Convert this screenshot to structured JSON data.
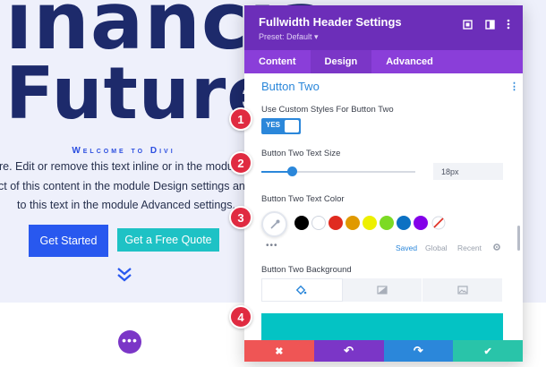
{
  "background_page": {
    "hero_word_1": "inancia",
    "hero_word_2": "Future",
    "welcome": "Welcome to Divi",
    "body_lines": [
      "ere. Edit or remove this text inline or in the module (",
      "ct of this content in the module Design settings and e",
      "to this text in the module Advanced settings."
    ],
    "primary_button": "Get Started",
    "secondary_button": "Get a Free Quote",
    "fab_label": "•••",
    "colors": {
      "hero_text": "#1d2a6b",
      "accent": "#2858ef",
      "teal": "#1ec2c5",
      "fab": "#7b36c7"
    }
  },
  "modal": {
    "title": "Fullwidth Header Settings",
    "preset": "Preset: Default ▾",
    "header_icons": [
      "fullscreen-icon",
      "split-view-icon",
      "more-options-icon"
    ],
    "tabs": [
      {
        "label": "Content",
        "active": false
      },
      {
        "label": "Design",
        "active": true
      },
      {
        "label": "Advanced",
        "active": false
      }
    ],
    "section_title": "Button Two",
    "custom_styles": {
      "label": "Use Custom Styles For Button Two",
      "toggle_text": "YES",
      "enabled": true
    },
    "text_size": {
      "label": "Button Two Text Size",
      "value": "18px",
      "slider_fraction": 0.19
    },
    "text_color": {
      "label": "Button Two Text Color",
      "swatches": [
        "#000000",
        "#ffffff",
        "#e02b20",
        "#e09900",
        "#edf000",
        "#7cda24",
        "#0c71c3",
        "#8300e9"
      ],
      "tabs": [
        "Saved",
        "Global",
        "Recent"
      ]
    },
    "background": {
      "label": "Button Two Background",
      "tab_icons": [
        "paint-bucket-icon",
        "gradient-icon",
        "image-icon"
      ],
      "preview_color": "#04c3c4"
    },
    "footer": [
      {
        "name": "discard-button",
        "symbol": "✖",
        "color": "#ef5555"
      },
      {
        "name": "undo-button",
        "symbol": "↶",
        "color": "#7b36c7"
      },
      {
        "name": "redo-button",
        "symbol": "↷",
        "color": "#2b87da"
      },
      {
        "name": "save-button",
        "symbol": "✔",
        "color": "#29c4a9"
      }
    ],
    "colors": {
      "header": "#6c2eb9",
      "tabs": "#8a3ed9",
      "accent": "#2b87da"
    }
  },
  "markers": [
    "1",
    "2",
    "3",
    "4"
  ]
}
